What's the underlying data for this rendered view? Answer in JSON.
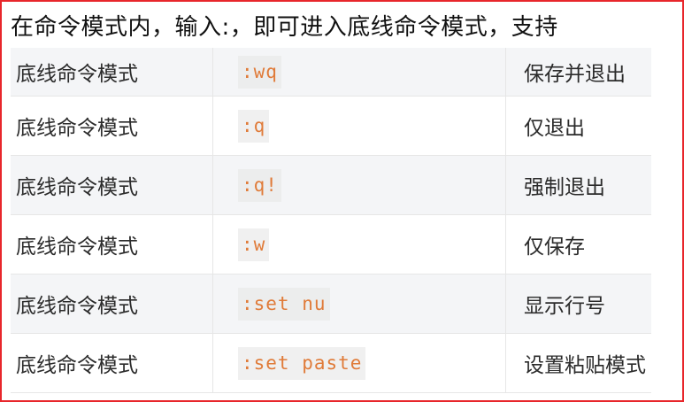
{
  "intro_text": "在命令模式内，输入:，即可进入底线命令模式，支持",
  "rows": [
    {
      "mode": "底线命令模式",
      "command": ":wq",
      "description": "保存并退出"
    },
    {
      "mode": "底线命令模式",
      "command": ":q",
      "description": "仅退出"
    },
    {
      "mode": "底线命令模式",
      "command": ":q!",
      "description": "强制退出"
    },
    {
      "mode": "底线命令模式",
      "command": ":w",
      "description": "仅保存"
    },
    {
      "mode": "底线命令模式",
      "command": ":set nu",
      "description": "显示行号"
    },
    {
      "mode": "底线命令模式",
      "command": ":set paste",
      "description": "设置粘贴模式"
    }
  ],
  "colors": {
    "frame_border": "#e8262b",
    "code_text": "#e07b39",
    "row_stripe": "#f4f5f7"
  }
}
